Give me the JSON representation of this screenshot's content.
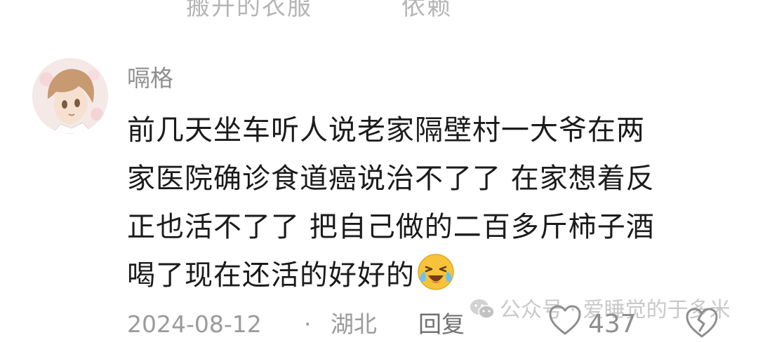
{
  "header_remnants": {
    "left": "搬开的衣服",
    "right": "依赖"
  },
  "comment": {
    "username": "嗝格",
    "avatar": "anime-avatar",
    "text_lines": [
      "前几天坐车听人说老家隔壁村一大爷在两",
      "家医院确诊食道癌说治不了了 在家想着反",
      "正也活不了了 把自己做的二百多斤柿子酒",
      "喝了现在还活的好好的"
    ],
    "emoji": "crying-laughing-emoji",
    "date": "2024-08-12",
    "separator": "·",
    "location": "湖北",
    "reply_label": "回复",
    "like_count": "437"
  },
  "watermark": {
    "icon": "wechat-icon",
    "text": "公众号 · 爱睡觉的于多米"
  },
  "colors": {
    "background": "#ffffff",
    "text_primary": "#1b1b1b",
    "text_secondary": "#8e8e8e",
    "emoji_yellow": "#f6c33a"
  }
}
